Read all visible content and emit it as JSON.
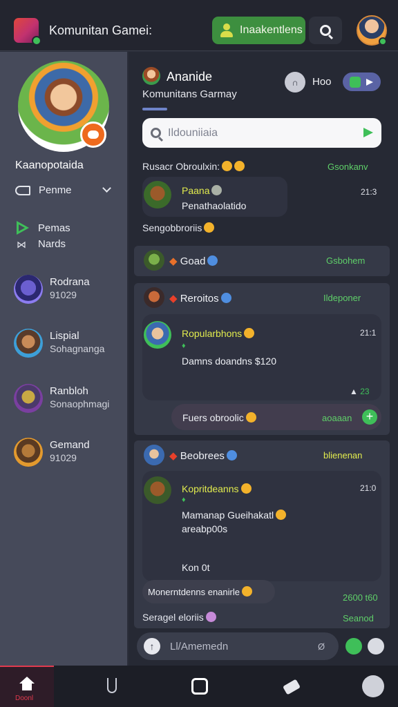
{
  "app": {
    "title": "Komunitan Gamei:",
    "invite_label": "Inaakentlens",
    "colors": {
      "accent_green": "#3fbf59",
      "brand_red": "#e23a4e",
      "author_yellow": "#e2ec4e"
    }
  },
  "sidebar": {
    "username": "Kaanopotaida",
    "persona_label": "Penme",
    "quick": [
      {
        "label": "Pemas",
        "icon": "play-icon"
      },
      {
        "label": "Nards",
        "icon": "flag-icon"
      }
    ],
    "friends": [
      {
        "name": "Rodrana",
        "sub": "91029"
      },
      {
        "name": "Lispial",
        "sub": "Sohagnanga"
      },
      {
        "name": "Ranbloh",
        "sub": "Sonaophmagi"
      },
      {
        "name": "Gemand",
        "sub": "91029"
      }
    ]
  },
  "room": {
    "name": "Ananide",
    "subtitle": "Komunitans Garmay",
    "mute_label": "Hoo",
    "search_placeholder": "Ildouniiaia"
  },
  "feed": {
    "header_left": "Rusacr Obroulxin:",
    "header_right": "Gsonkanv",
    "msg1": {
      "author": "Paana",
      "text": "Penathaolatido",
      "time": "21:3"
    },
    "footer1": "Sengobbroriis",
    "card2": {
      "title": "Goad",
      "status": "Gsbohem"
    },
    "card3": {
      "title": "Reroitos",
      "status": "Ildeponer",
      "author": "Ropularbhons",
      "sub": "♦",
      "text": "Damns doandns $120",
      "time": "21:1",
      "reaction_count": "23",
      "reply": "Fuers obroolic",
      "reply_status": "aoaaan"
    },
    "card4": {
      "title": "Beobrees",
      "status": "blienenan",
      "author": "Kopritdeanns",
      "sub": "♦",
      "text_line1": "Mamanap Gueihakatl",
      "text_line2": "areabp00s",
      "text_line3": "Kon 0t",
      "time": "21:0",
      "reply": "Monerntdenns enanirle",
      "reply_time": "2600 t60"
    },
    "footer2": "Seragel eloriis",
    "footer2_status": "Seanod"
  },
  "composer": {
    "placeholder": "Ll/Amemedn",
    "count": "Ø"
  },
  "nav": {
    "home_label": "Doonl"
  }
}
